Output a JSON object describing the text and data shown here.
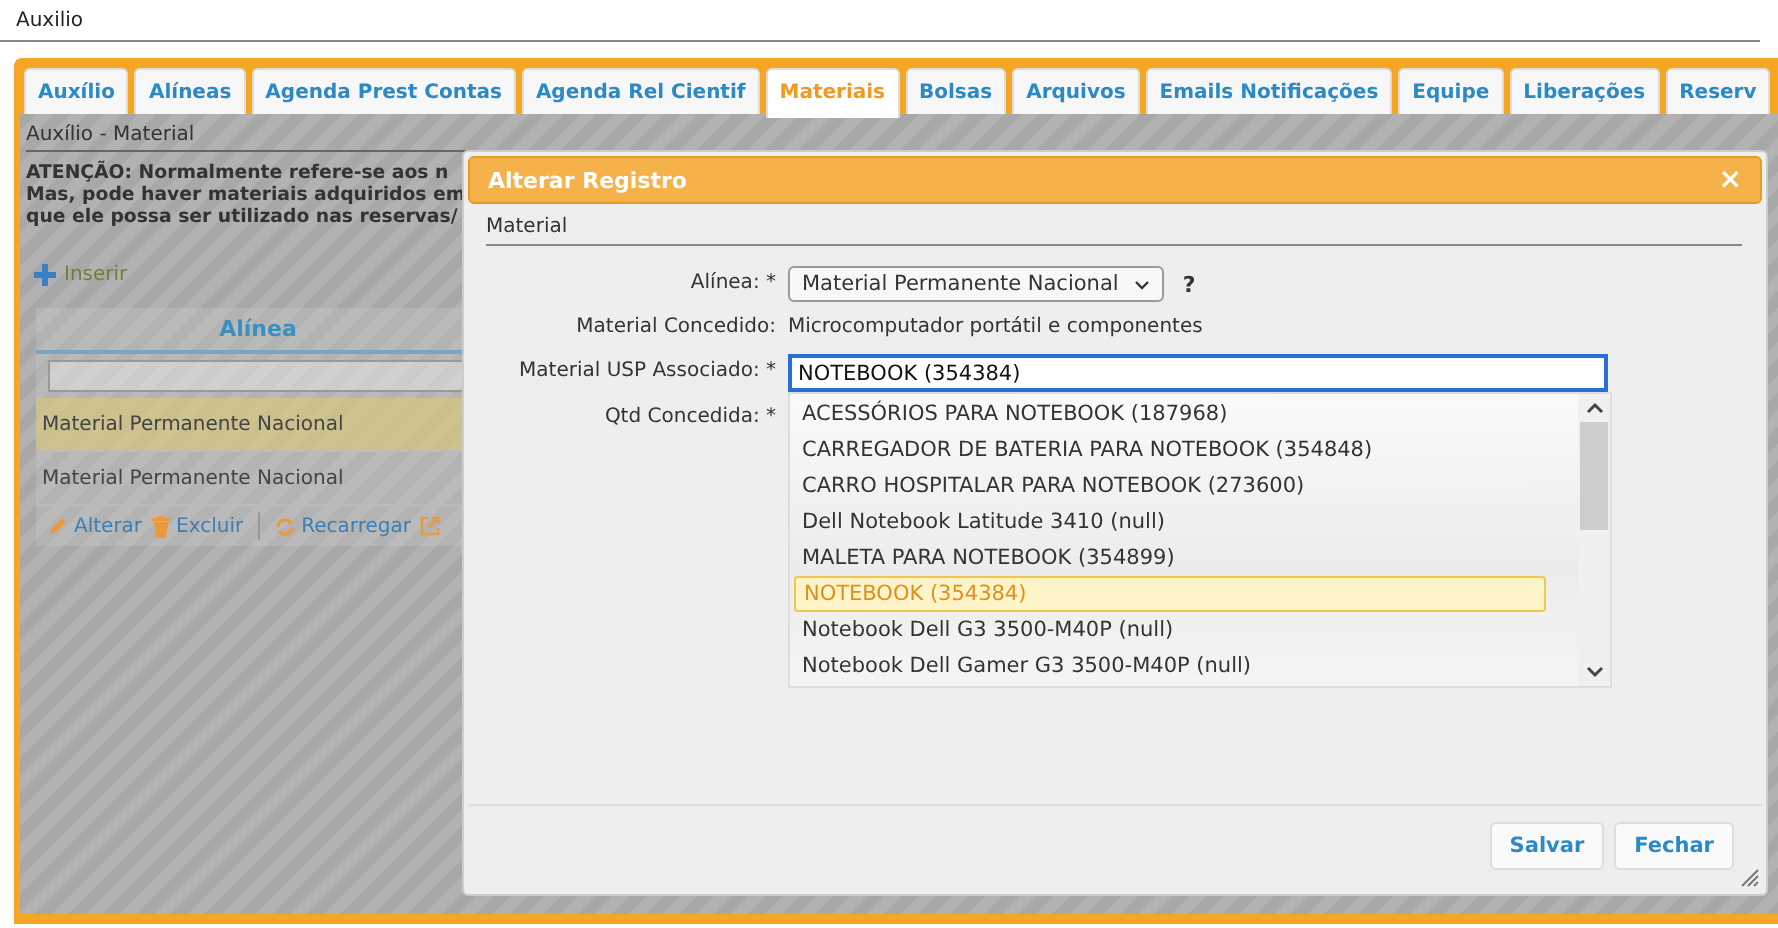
{
  "page_title": "Auxilio",
  "tabs": [
    {
      "label": "Auxílio",
      "selected": false
    },
    {
      "label": "Alíneas",
      "selected": false
    },
    {
      "label": "Agenda Prest Contas",
      "selected": false
    },
    {
      "label": "Agenda Rel Cientif",
      "selected": false
    },
    {
      "label": "Materiais",
      "selected": true
    },
    {
      "label": "Bolsas",
      "selected": false
    },
    {
      "label": "Arquivos",
      "selected": false
    },
    {
      "label": "Emails Notificações",
      "selected": false
    },
    {
      "label": "Equipe",
      "selected": false
    },
    {
      "label": "Liberações",
      "selected": false
    },
    {
      "label": "Reserv",
      "selected": false
    }
  ],
  "breadcrumb": "Auxílio - Material",
  "notice_lines": [
    "ATENÇÃO: Normalmente refere-se aos n",
    "Mas, pode haver materiais adquiridos em",
    "que ele possa ser utilizado nas reservas/"
  ],
  "insert_link": "Inserir",
  "table": {
    "columns": [
      "Alínea"
    ],
    "rows": [
      {
        "cells": [
          "Material Permanente Nacional"
        ],
        "selected": true
      },
      {
        "cells": [
          "Material Permanente Nacional"
        ],
        "selected": false
      }
    ],
    "toolbar": [
      {
        "label": "Alterar",
        "kind": "edit"
      },
      {
        "label": "Excluir",
        "kind": "delete"
      },
      {
        "label": "Recarregar",
        "kind": "reload"
      },
      {
        "kind": "export"
      }
    ]
  },
  "dialog": {
    "title": "Alterar Registro",
    "close": "×",
    "section": "Material",
    "fields": [
      {
        "label": "Alínea: *",
        "kind": "select",
        "value": "Material Permanente Nacional",
        "help": "?"
      },
      {
        "label": "Material Concedido:",
        "kind": "text",
        "value": "Microcomputador portátil e componentes"
      },
      {
        "label": "Material USP Associado: *",
        "kind": "input",
        "value": "NOTEBOOK (354384)"
      },
      {
        "label": "Qtd Concedida: *",
        "kind": "hidden"
      }
    ],
    "suggestions": [
      {
        "label": "ACESSÓRIOS PARA NOTEBOOK (187968)",
        "selected": false
      },
      {
        "label": "CARREGADOR DE BATERIA PARA NOTEBOOK (354848)",
        "selected": false
      },
      {
        "label": "CARRO HOSPITALAR PARA NOTEBOOK (273600)",
        "selected": false
      },
      {
        "label": "Dell Notebook Latitude 3410 (null)",
        "selected": false
      },
      {
        "label": "MALETA PARA NOTEBOOK (354899)",
        "selected": false
      },
      {
        "label": "NOTEBOOK (354384)",
        "selected": true
      },
      {
        "label": "Notebook Dell G3 3500-M40P (null)",
        "selected": false
      },
      {
        "label": "Notebook Dell Gamer G3 3500-M40P (null)",
        "selected": false
      }
    ],
    "buttons": [
      "Salvar",
      "Fechar"
    ]
  }
}
